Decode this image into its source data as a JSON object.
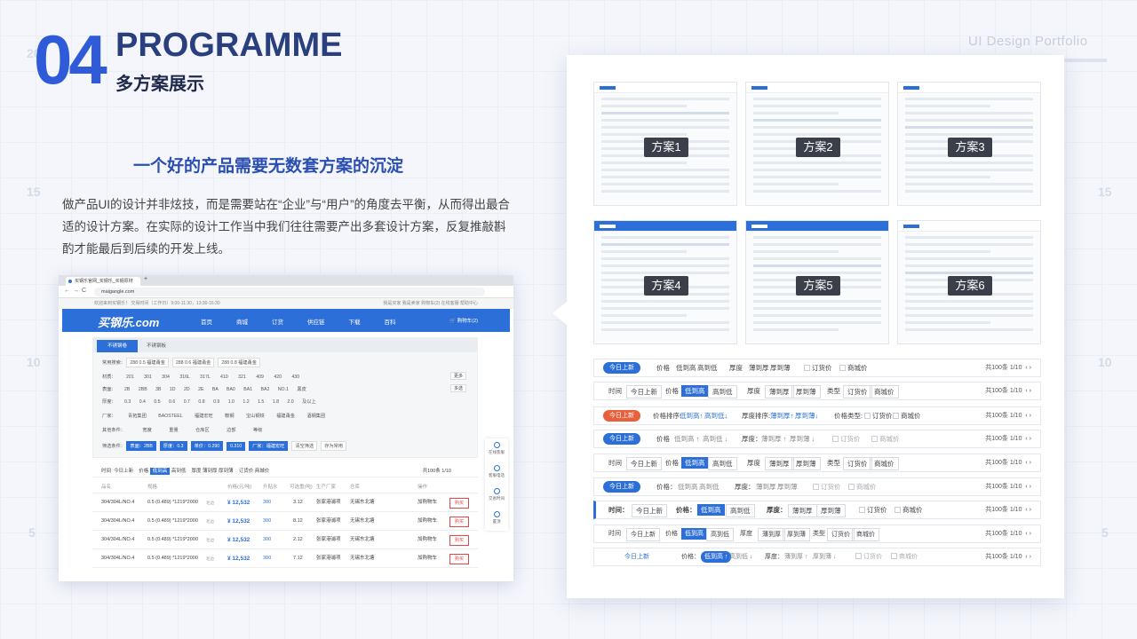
{
  "header": {
    "number": "04",
    "title": "PROGRAMME",
    "subtitle": "多方案展示",
    "portfolio": "UI Design Portfolio"
  },
  "slogan": "一个好的产品需要无数套方案的沉淀",
  "description": "做产品UI的设计并非炫技，而是需要站在“企业”与“用户”的角度去平衡，从而得出最合适的设计方案。在实际的设计工作当中我们往往需要产出多套设计方案，反复推敲斟酌才能最后到后续的开发上线。",
  "grid_numbers": {
    "n20": "20",
    "n15": "15",
    "n10": "10",
    "n5": "5"
  },
  "browser": {
    "tab_title": "买钢乐官网_买钢乐_买钢原材",
    "url": "maigangle.com",
    "topbar_left": "欢迎来到买钢乐！ 交易时间（工作日）9:00-11:30，13:30-16:30",
    "topbar_right": "我是买家  我是卖家  购物车(2)  在线客服  帮助中心",
    "logo": "买钢乐.com",
    "menu": [
      "首页",
      "商城",
      "订货",
      "供应链",
      "下载",
      "百科"
    ],
    "cart": "购物车(2)",
    "tab_on": "不锈钢卷",
    "tab_off": "不锈钢板",
    "filters": {
      "common_label": "常用搜索：",
      "common": [
        "288 0.5 福建甬金",
        "288 0.6 福建甬金",
        "288 0.8 福建甬金"
      ],
      "material_label": "材质：",
      "material": [
        "201",
        "301",
        "304",
        "316L",
        "317L",
        "410",
        "321",
        "409",
        "420",
        "430"
      ],
      "surface_label": "表面：",
      "surface": [
        "2B",
        "2BB",
        "3B",
        "1D",
        "2D",
        "2E",
        "BA",
        "BA0",
        "BA1",
        "BA2",
        "NO.1",
        "黑皮"
      ],
      "thickness_label": "厚度：",
      "thickness": [
        "0.3",
        "0.4",
        "0.5",
        "0.6",
        "0.7",
        "0.8",
        "0.9",
        "1.0",
        "1.2",
        "1.5",
        "1.8",
        "2.0 及以上"
      ],
      "factory_label": "厂家：",
      "factory": [
        "青拓集团",
        "BAOSTEEL",
        "福建宏旺",
        "鞍钢",
        "宝山钢铁",
        "福建甬金",
        "酒钢集团"
      ],
      "other_label": "其他条件：",
      "other": [
        "宽度",
        "重量",
        "仓库区",
        "边部",
        "等级"
      ],
      "selected_label": "筛选条件：",
      "selected": [
        "表面：2BB",
        "厚度：0.3",
        "单价：0.290",
        "0.310",
        "厂家：福建宏旺"
      ],
      "clear": "清空筛选",
      "save": "存为常用",
      "more": "更多",
      "multi": "多选"
    },
    "sortbar": {
      "time": "时间",
      "today": "今日上新",
      "price": "价格",
      "low_high": "低到高",
      "high_low": "高到低",
      "thick": "厚度",
      "thin_thick": "薄到厚",
      "thick_thin": "厚到薄",
      "order": "订货价",
      "mall": "商城价",
      "total": "共100条",
      "page": "1/10"
    },
    "table_headers": [
      "品名",
      "规格",
      "价格(元/吨)",
      "升贴水",
      "可选重(吨)",
      "生产厂家",
      "仓库",
      "操作"
    ],
    "rows": [
      {
        "name": "304/304L/NO.4",
        "spec": "0.5 (0.489) *1219*2000",
        "tag": "毛边",
        "price": "¥ 12,532",
        "premium": "300",
        "weight": "3.12",
        "factory": "张家港浦项",
        "warehouse": "无锡东北塘",
        "cart": "加购物车",
        "buy": "购买"
      },
      {
        "name": "304/304L/NO.4",
        "spec": "0.5 (0.489) *1219*2000",
        "tag": "毛边",
        "price": "¥ 12,532",
        "premium": "300",
        "weight": "8.12",
        "factory": "张家港浦项",
        "warehouse": "无锡东北塘",
        "cart": "加购物车",
        "buy": "购买"
      },
      {
        "name": "304/304L/NO.4",
        "spec": "0.5 (0.489) *1219*2000",
        "tag": "毛边",
        "price": "¥ 12,532",
        "premium": "300",
        "weight": "2.12",
        "factory": "张家港浦项",
        "warehouse": "无锡东北塘",
        "cart": "加购物车",
        "buy": "购买"
      },
      {
        "name": "304/304L/NO.4",
        "spec": "0.5 (0.489) *1219*2000",
        "tag": "毛边",
        "price": "¥ 12,532",
        "premium": "300",
        "weight": "7.12",
        "factory": "张家港浦项",
        "warehouse": "无锡东北塘",
        "cart": "加购物车",
        "buy": "购买"
      }
    ],
    "side": [
      "在线客服",
      "客服电话",
      "交易时间",
      "置顶"
    ]
  },
  "schemes": [
    "方案1",
    "方案2",
    "方案3",
    "方案4",
    "方案5",
    "方案6"
  ],
  "bars": {
    "today": "今日上新",
    "time": "时间",
    "time_colon": "时间：",
    "price": "价格",
    "price_colon": "价格：",
    "low_high": "低到高",
    "high_low": "高到低",
    "low_high_arrow": "低到高 ↑",
    "high_low_arrow": "高到低 ↓",
    "low_high_up": "低到高↑",
    "high_low_down": "高到低↓",
    "thick": "厚度",
    "thick_colon": "厚度：",
    "thin_thick": "薄到厚",
    "thick_thin": "厚到薄",
    "thin_thick_arrow": "薄到厚 ↑",
    "thick_thin_arrow": "厚到薄 ↓",
    "thin_thick_up": "薄到厚↑",
    "thick_thin_down": "厚到薄↓",
    "price_sort": "价格排序:",
    "thick_sort": "厚度排序:",
    "price_type": "价格类型:",
    "type": "类型",
    "order": "订货价",
    "mall": "商城价",
    "total": "共100条",
    "page": "1/10"
  },
  "colors": {
    "accent": "#2c6fd8",
    "heading": "#2a3f7d",
    "number": "#2f5bd8",
    "danger": "#e8603c"
  }
}
